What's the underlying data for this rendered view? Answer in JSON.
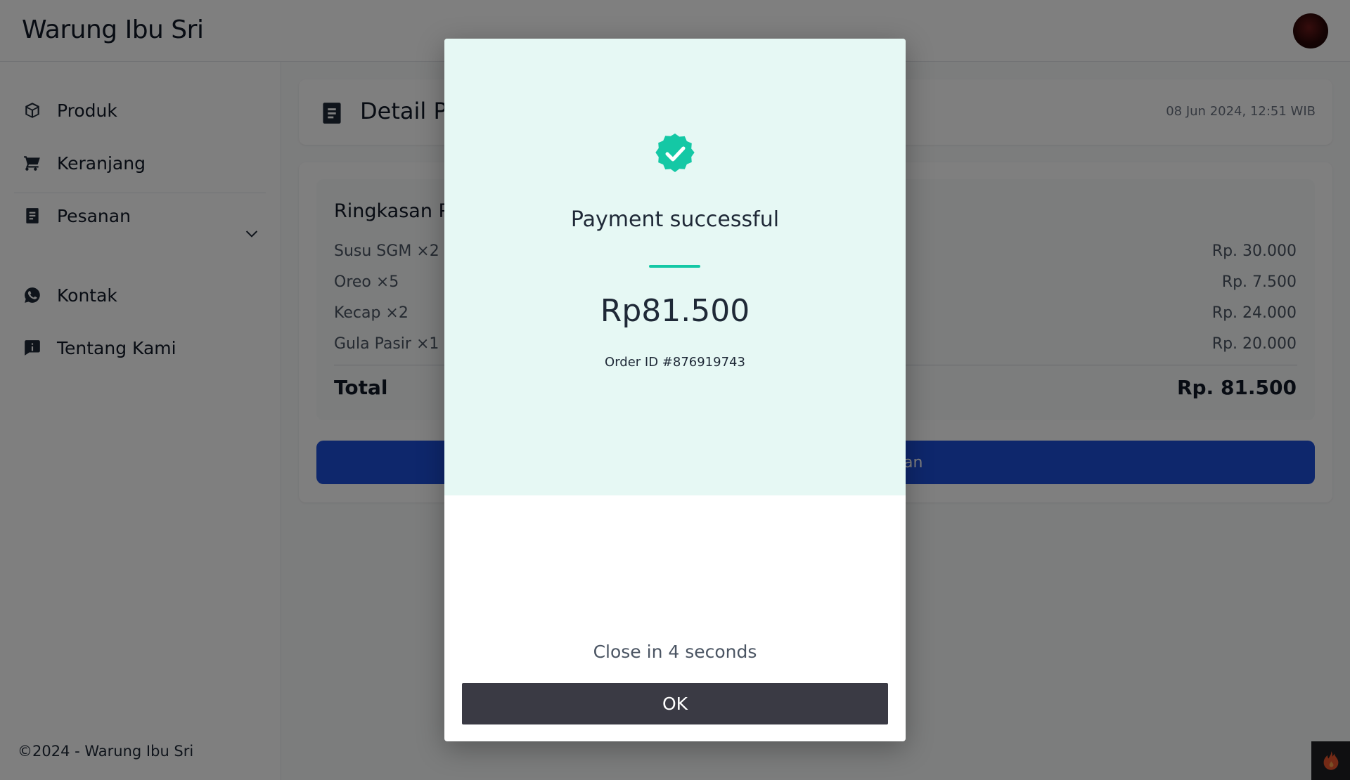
{
  "app": {
    "brand": "Warung Ibu Sri"
  },
  "sidebar": {
    "items": [
      {
        "label": "Produk",
        "icon": "box-icon"
      },
      {
        "label": "Keranjang",
        "icon": "cart-icon"
      },
      {
        "label": "Pesanan",
        "icon": "receipt-icon"
      },
      {
        "label": "Kontak",
        "icon": "whatsapp-icon",
        "expandable": true
      },
      {
        "label": "Tentang Kami",
        "icon": "info-icon"
      }
    ],
    "footer": "©2024 - Warung Ibu Sri"
  },
  "page": {
    "title": "Detail Pe",
    "datetime": "08 Jun 2024, 12:51 WIB"
  },
  "summary": {
    "title": "Ringkasan P",
    "items": [
      {
        "name": "Susu SGM ×2",
        "price": "Rp. 30.000"
      },
      {
        "name": "Oreo ×5",
        "price": "Rp. 7.500"
      },
      {
        "name": "Kecap ×2",
        "price": "Rp. 24.000"
      },
      {
        "name": "Gula Pasir ×1",
        "price": "Rp. 20.000"
      }
    ],
    "total_label": "Total",
    "total_value": "Rp. 81.500",
    "action_label": "an"
  },
  "modal": {
    "title": "Payment successful",
    "amount": "Rp81.500",
    "order_id": "Order ID #876919743",
    "countdown": "Close in 4 seconds",
    "ok_label": "OK",
    "accent_color": "#14c8a5",
    "top_bg_color": "#e6f8f4"
  },
  "colors": {
    "primary_button": "#1d4ed8",
    "ok_button": "#3a3a44"
  }
}
